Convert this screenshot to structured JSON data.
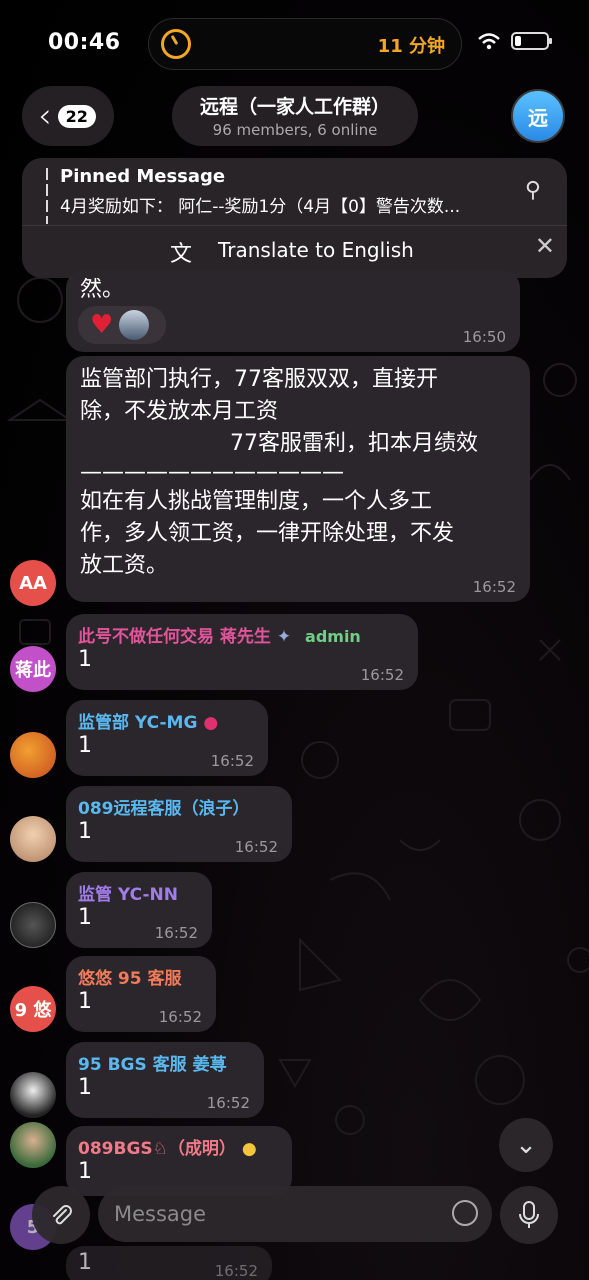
{
  "status_bar": {
    "time": "00:46",
    "timer": "11 分钟"
  },
  "header": {
    "back_count": "22",
    "title": "远程（一家人工作群）",
    "subtitle": "96 members, 6 online",
    "avatar_text": "远"
  },
  "pinned": {
    "label": "Pinned Message",
    "text": "4月奖励如下：  阿仁--奖励1分（4月【0】警告次数...",
    "translate_label": "Translate to English"
  },
  "messages": [
    {
      "tail_text": "然。",
      "time": "16:50"
    },
    {
      "avatar": "AA",
      "avatar_color": "#e5504a",
      "lines": [
        "监管部门执行，77客服双双，直接开",
        "除，不发放本月工资",
        "77客服雷利，扣本月绩效",
        "————————————",
        "如在有人挑战管理制度，一个人多工",
        "作，多人领工资，一律开除处理，不发",
        "放工资。"
      ],
      "time": "16:52"
    },
    {
      "avatar": "蒋此",
      "avatar_color": "#c150c9",
      "name": "此号不做任何交易 蒋先生",
      "name_color": "#e0559a",
      "badge": "admin",
      "text": "1",
      "time": "16:52"
    },
    {
      "avatar": "",
      "avatar_color": "#c84a20",
      "name": "监管部 YC-MG",
      "name_color": "#5ab8f0",
      "text": "1",
      "time": "16:52"
    },
    {
      "avatar": "",
      "avatar_color": "#c9a27a",
      "name": "089远程客服（浪子）",
      "name_color": "#5ab8f0",
      "text": "1",
      "time": "16:52"
    },
    {
      "avatar": "",
      "avatar_color": "#2c2c2c",
      "name": "监管 YC-NN",
      "name_color": "#a07de8",
      "text": "1",
      "time": "16:52"
    },
    {
      "avatar": "9 悠",
      "avatar_color": "#e5504a",
      "name": "悠悠 95 客服",
      "name_color": "#f07a5a",
      "text": "1",
      "time": "16:52"
    },
    {
      "avatar": "",
      "avatar_color": "#e8e8e8",
      "name": "95 BGS 客服 姜荨",
      "name_color": "#5ab8f0",
      "text": "1",
      "time": "16:52"
    },
    {
      "avatar": "",
      "avatar_color": "#5a8f5a",
      "name": "089BGS♘（成明）",
      "name_color": "#f07a8a",
      "text": "1",
      "time": "16:52"
    },
    {
      "avatar": "5",
      "avatar_color": "#8a5ac9",
      "name": "",
      "name_color": "#a07de8",
      "text": "1",
      "time": "16:52"
    }
  ],
  "composer": {
    "placeholder": "Message"
  },
  "colors": {
    "accent": "#2a8ae6",
    "bubble": "#2b262b",
    "timer": "#f5a623"
  }
}
